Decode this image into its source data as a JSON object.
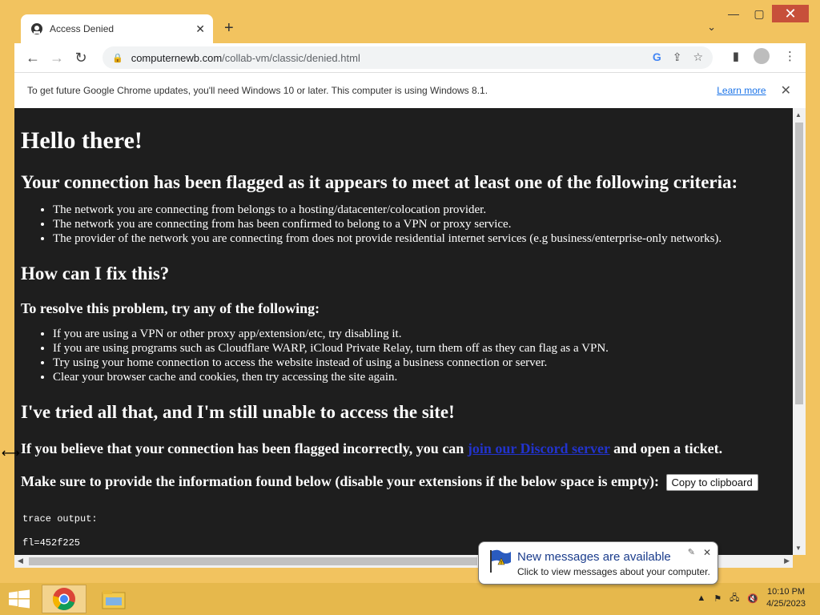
{
  "browser": {
    "tab_title": "Access Denied",
    "url_host": "computernewb.com",
    "url_path": "/collab-vm/classic/denied.html",
    "infobar_message": "To get future Google Chrome updates, you'll need Windows 10 or later. This computer is using Windows 8.1.",
    "infobar_link": "Learn more"
  },
  "page": {
    "heading1": "Hello there!",
    "heading2": "Your connection has been flagged as it appears to meet at least one of the following criteria:",
    "criteria": [
      "The network you are connecting from belongs to a hosting/datacenter/colocation provider.",
      "The network you are connecting from has been confirmed to belong to a VPN or proxy service.",
      "The provider of the network you are connecting from does not provide residential internet services (e.g business/enterprise-only networks)."
    ],
    "fix_heading": "How can I fix this?",
    "resolve_heading": "To resolve this problem, try any of the following:",
    "fixes": [
      "If you are using a VPN or other proxy app/extension/etc, try disabling it.",
      "If you are using programs such as Cloudflare WARP, iCloud Private Relay, turn them off as they can flag as a VPN.",
      "Try using your home connection to access the website instead of using a business connection or server.",
      "Clear your browser cache and cookies, then try accessing the site again."
    ],
    "tried_heading": "I've tried all that, and I'm still unable to access the site!",
    "flagged_pre": "If you believe that your connection has been flagged incorrectly, you can ",
    "flagged_link": "join our Discord server",
    "flagged_post": " and open a ticket.",
    "provide_info": "Make sure to provide the information found below (disable your extensions if the below space is empty):",
    "copy_button": "Copy to clipboard",
    "trace_label": "trace output:",
    "trace_line1": "fl=452f225"
  },
  "notification": {
    "title": "New messages are available",
    "body": "Click to view messages about your computer."
  },
  "taskbar": {
    "time": "10:10 PM",
    "date": "4/25/2023"
  },
  "colors": {
    "frame": "#f2c35f",
    "page_bg": "#1e1e1e",
    "link": "#2233cc"
  }
}
